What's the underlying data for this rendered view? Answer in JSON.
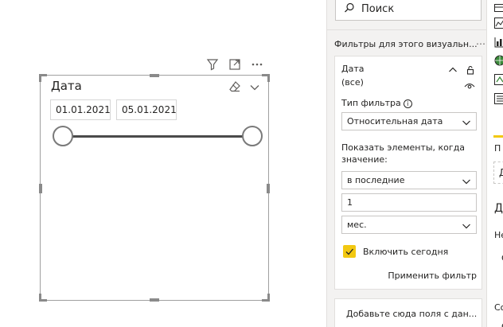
{
  "slicer": {
    "title": "Дата",
    "start_date": "01.01.2021",
    "end_date": "05.01.2021"
  },
  "filter_pane": {
    "search_placeholder": "Поиск",
    "section_title": "Фильтры для этого визуальн...",
    "section_more": "⋯",
    "card": {
      "field_name": "Дата",
      "field_value": "(все)",
      "filter_type_label": "Тип фильтра",
      "filter_type_value": "Относительная дата",
      "show_items_label": "Показать элементы, когда значение:",
      "period_value": "в последние",
      "count_value": "1",
      "unit_value": "мес.",
      "include_today_label": "Включить сегодня",
      "include_today_checked": true,
      "apply_label": "Применить фильтр"
    },
    "add_field_label": "Добавьте сюда поля с дан..."
  },
  "viz_pane": {
    "frag_1": "П",
    "frag_2": "Д",
    "frag_3": "Д",
    "frag_4": "Не",
    "frag_5": "С",
    "frag_6": "Со",
    "frag_7": "С"
  },
  "colors": {
    "accent": "#f2c811",
    "border": "#a0a0a0",
    "pane_bg": "#f3f2f1"
  }
}
